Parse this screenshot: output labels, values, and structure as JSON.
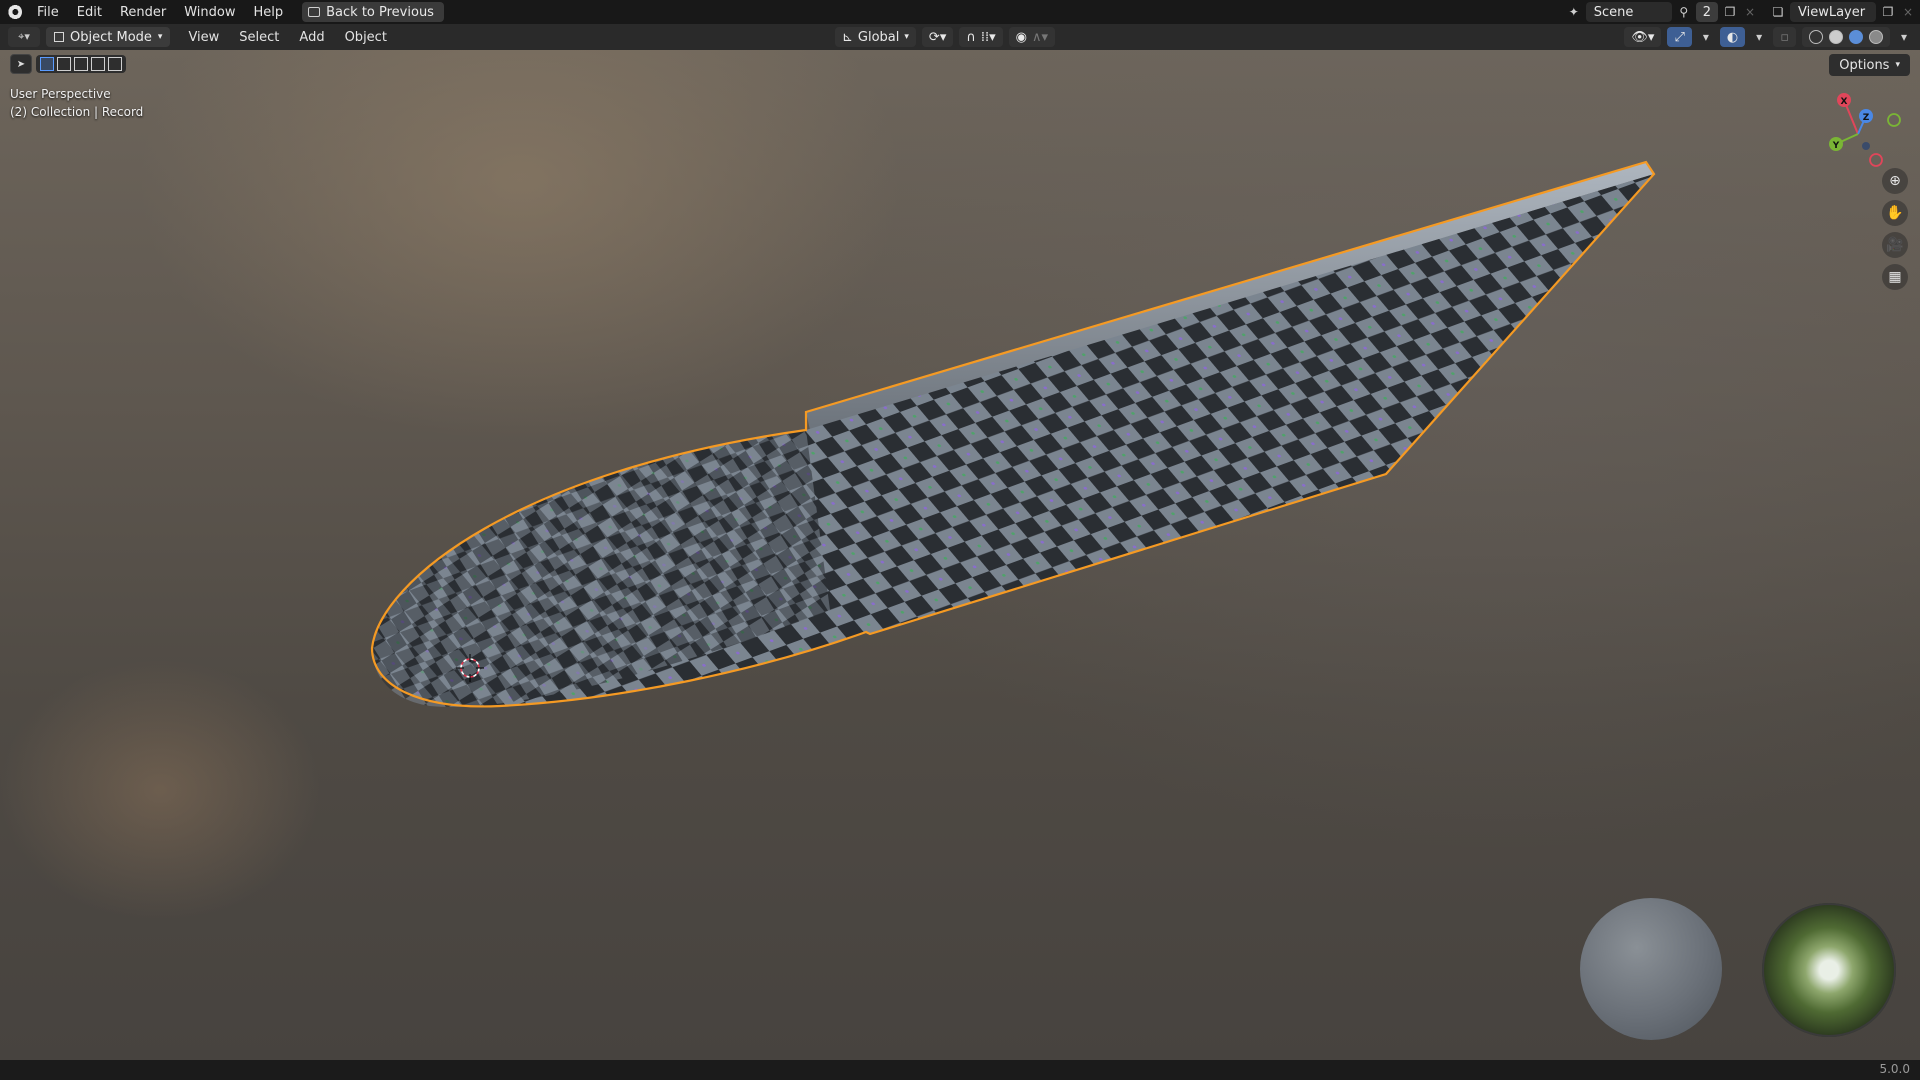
{
  "topbar": {
    "menus": [
      "File",
      "Edit",
      "Render",
      "Window",
      "Help"
    ],
    "back_button": "Back to Previous",
    "scene_name": "Scene",
    "scene_count": "2",
    "view_layer": "ViewLayer"
  },
  "header": {
    "mode": "Object Mode",
    "menus": [
      "View",
      "Select",
      "Add",
      "Object"
    ],
    "transform_orientation": "Global",
    "options_label": "Options"
  },
  "viewport": {
    "view_name": "User Perspective",
    "collection_info": "(2) Collection | Record",
    "gizmo_axes": {
      "x": "X",
      "y": "Y",
      "z": "Z"
    },
    "selected_outline_color": "#f59a23"
  },
  "status": {
    "version": "5.0.0"
  }
}
